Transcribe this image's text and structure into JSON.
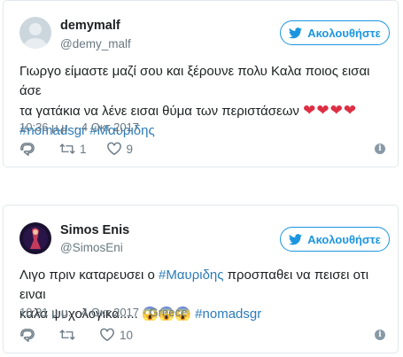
{
  "tweets": [
    {
      "name": "demymalf",
      "handle": "@demy_malf",
      "follow_label": "Ακολουθήστε",
      "text_line1": "Γιωργο είμαστε μαζί σου και ξέρουνε πολυ Καλα ποιος εισαι άσε",
      "text_line2": "τα γατάκια να λένε εισαι θύμα των περιστάσεων",
      "hearts": "❤❤❤❤",
      "hashtag1": "#nomadsgr",
      "hashtag2": "#Μαυριδης",
      "timestamp": "10:36 μ.μ. - 4 Οκτ 2017",
      "retweets": "1",
      "likes": "9"
    },
    {
      "name": "Simos Enis",
      "handle": "@SimosEni",
      "follow_label": "Ακολουθήστε",
      "text_a": "Λιγο πριν καταρευσει ο ",
      "hashtag_mid": "#Μαυριδης",
      "text_b": " προσπαθει να πεισει οτι ειναι",
      "text_line2": "καλα ψυχολογικα..... ",
      "emojis": "😱😱😱",
      "hashtag_end": "#nomadsgr",
      "timestamp": "10:31 μ.μ. - 4 Οκτ 2017 · Greece",
      "likes": "10"
    }
  ],
  "colors": {
    "accent": "#1b95e0",
    "link": "#2b7bb9",
    "muted": "#697882",
    "heart": "#dd2e44"
  }
}
